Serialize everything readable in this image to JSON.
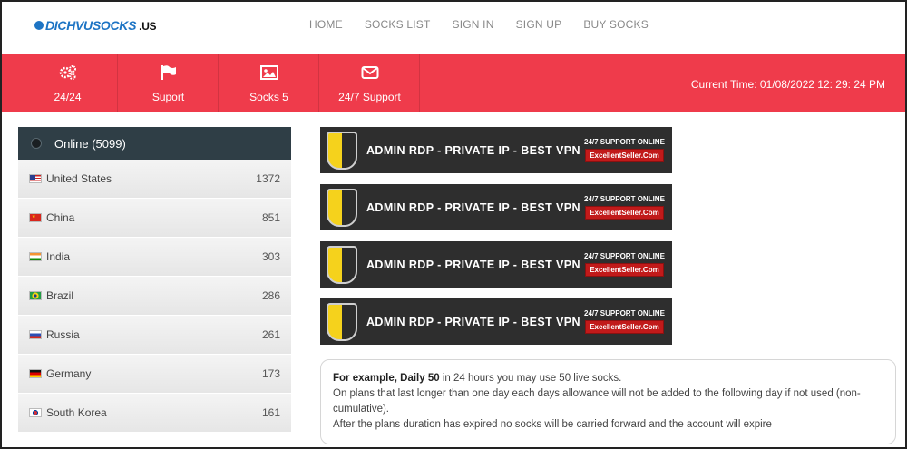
{
  "header": {
    "logo_text": "DICHVUSOCKS",
    "logo_suffix": ".US",
    "nav": [
      "HOME",
      "SOCKS LIST",
      "SIGN IN",
      "SIGN UP",
      "BUY SOCKS"
    ]
  },
  "band": {
    "features": [
      {
        "icon": "gears-icon",
        "label": "24/24"
      },
      {
        "icon": "flag-icon",
        "label": "Suport"
      },
      {
        "icon": "image-icon",
        "label": "Socks 5"
      },
      {
        "icon": "envelope-icon",
        "label": "24/7 Support"
      }
    ],
    "current_time": "Current Time: 01/08/2022 12: 29: 24 PM"
  },
  "countries": {
    "title": "Online (5099)",
    "rows": [
      {
        "name": "United States",
        "count": "1372",
        "flag": "us"
      },
      {
        "name": "China",
        "count": "851",
        "flag": "cn"
      },
      {
        "name": "India",
        "count": "303",
        "flag": "in"
      },
      {
        "name": "Brazil",
        "count": "286",
        "flag": "br"
      },
      {
        "name": "Russia",
        "count": "261",
        "flag": "ru"
      },
      {
        "name": "Germany",
        "count": "173",
        "flag": "de"
      },
      {
        "name": "South Korea",
        "count": "161",
        "flag": "kr"
      }
    ]
  },
  "ads": [
    {
      "title": "ADMIN RDP - PRIVATE IP - BEST VPN",
      "support": "24/7 SUPPORT ONLINE",
      "seller": "ExcellentSeller.Com"
    },
    {
      "title": "ADMIN RDP - PRIVATE IP - BEST VPN",
      "support": "24/7 SUPPORT ONLINE",
      "seller": "ExcellentSeller.Com"
    },
    {
      "title": "ADMIN RDP - PRIVATE IP - BEST VPN",
      "support": "24/7 SUPPORT ONLINE",
      "seller": "ExcellentSeller.Com"
    },
    {
      "title": "ADMIN RDP - PRIVATE IP - BEST VPN",
      "support": "24/7 SUPPORT ONLINE",
      "seller": "ExcellentSeller.Com"
    }
  ],
  "info": {
    "bold": "For example, Daily 50",
    "line1_rest": " in 24 hours you may use 50 live socks.",
    "line2": "On plans that last longer than one day each days allowance will not be added to the following day if not used (non-cumulative).",
    "line3": "After the plans duration has expired no socks will be carried forward and the account will expire"
  },
  "colors": {
    "band": "#ef3b4b",
    "panel_header": "#2f3e46",
    "ad_background": "#2e2e2e",
    "seller_badge": "#c11a1a"
  }
}
